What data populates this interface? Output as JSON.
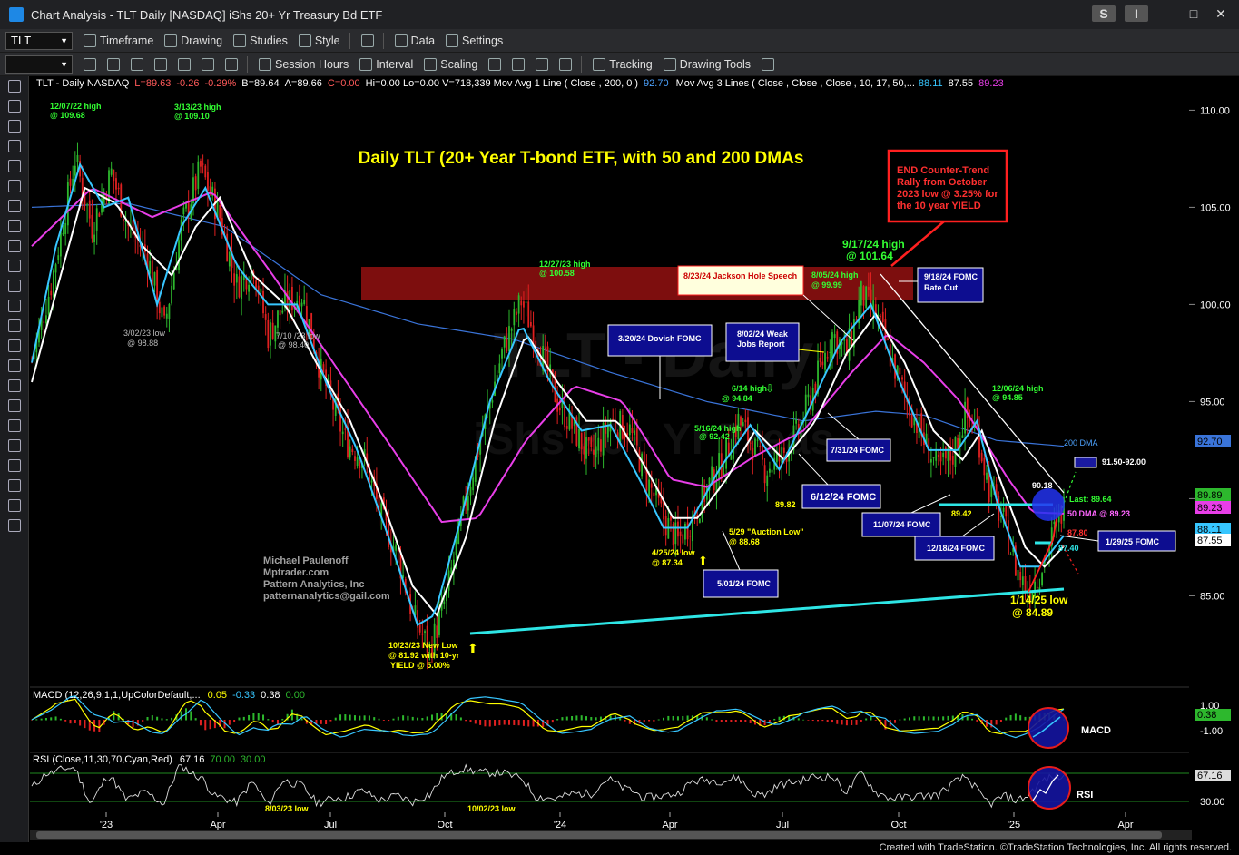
{
  "window": {
    "title": "Chart Analysis - TLT Daily [NASDAQ] iShs 20+ Yr Treasury Bd ETF",
    "btn_s": "S",
    "btn_i": "I"
  },
  "toolbar1": {
    "symbol": "TLT",
    "timeframe": "Timeframe",
    "drawing": "Drawing",
    "studies": "Studies",
    "style": "Style",
    "data": "Data",
    "settings": "Settings"
  },
  "toolbar2": {
    "session": "Session Hours",
    "interval": "Interval",
    "scaling": "Scaling",
    "tracking": "Tracking",
    "drawing_tools": "Drawing Tools"
  },
  "header": {
    "sym": "TLT - Daily NASDAQ",
    "last": "L=89.63",
    "chg": "-0.26",
    "pct": "-0.29%",
    "bid": "B=89.64",
    "ask": "A=89.66",
    "net": "C=0.00",
    "rest": "Hi=0.00  Lo=0.00  V=718,339  Mov Avg 1 Line ( Close , 200,  0 )",
    "ma1": "92.70",
    "ma3": "Mov Avg 3 Lines ( Close , Close , Close , 10, 17, 50,...",
    "ma3a": "88.11",
    "ma3b": "87.55",
    "ma3c": "89.23"
  },
  "colors": {
    "up": "#2db82d",
    "down": "#e02020",
    "ma10": "#37c6ff",
    "ma17": "#ffffff",
    "ma50": "#e83ee8",
    "ma200": "#3a74d9",
    "resist": "#8b1010",
    "trend": "#2ee6e6",
    "ann": "#ffff00",
    "green": "#33ff33"
  },
  "chart_data": {
    "type": "candlestick",
    "title": "Daily TLT (20+ Year T-bond ETF, with 50 and 200 DMAs",
    "ylim": [
      81,
      111
    ],
    "y_ticks": [
      "110.00",
      "105.00",
      "100.00",
      "95.00",
      "90.00",
      "85.00"
    ],
    "x_ticks": [
      "'23",
      "Apr",
      "Jul",
      "Oct",
      "'24",
      "Apr",
      "Jul",
      "Oct",
      "'25",
      "Apr"
    ],
    "price_path": [
      [
        0,
        97.2
      ],
      [
        8,
        101
      ],
      [
        18,
        107.5
      ],
      [
        25,
        104
      ],
      [
        33,
        106.8
      ],
      [
        40,
        104
      ],
      [
        48,
        102.5
      ],
      [
        55,
        98.8
      ],
      [
        62,
        104
      ],
      [
        70,
        107
      ],
      [
        78,
        104.5
      ],
      [
        85,
        101
      ],
      [
        92,
        102
      ],
      [
        98,
        98.4
      ],
      [
        105,
        100
      ],
      [
        112,
        100.5
      ],
      [
        120,
        96.5
      ],
      [
        130,
        93
      ],
      [
        138,
        92
      ],
      [
        145,
        89
      ],
      [
        152,
        87
      ],
      [
        158,
        84
      ],
      [
        165,
        82.2
      ],
      [
        172,
        85
      ],
      [
        180,
        90
      ],
      [
        188,
        94
      ],
      [
        195,
        97.5
      ],
      [
        203,
        100.2
      ],
      [
        210,
        98
      ],
      [
        218,
        95
      ],
      [
        225,
        93.5
      ],
      [
        232,
        92
      ],
      [
        240,
        94
      ],
      [
        248,
        93.5
      ],
      [
        255,
        91
      ],
      [
        262,
        89
      ],
      [
        268,
        87.8
      ],
      [
        274,
        89
      ],
      [
        280,
        90.5
      ],
      [
        287,
        92
      ],
      [
        293,
        94
      ],
      [
        298,
        93
      ],
      [
        304,
        91.5
      ],
      [
        310,
        92
      ],
      [
        318,
        93.5
      ],
      [
        325,
        96
      ],
      [
        332,
        98.5
      ],
      [
        338,
        97.5
      ],
      [
        344,
        100.5
      ],
      [
        350,
        99.5
      ],
      [
        357,
        97
      ],
      [
        363,
        95
      ],
      [
        370,
        93
      ],
      [
        376,
        91.5
      ],
      [
        382,
        92.3
      ],
      [
        387,
        94.3
      ],
      [
        392,
        93.5
      ],
      [
        397,
        90.5
      ],
      [
        403,
        88.8
      ],
      [
        408,
        86.5
      ],
      [
        413,
        85.2
      ],
      [
        418,
        86.2
      ],
      [
        423,
        88
      ],
      [
        428,
        89.6
      ]
    ],
    "last_x": 428,
    "series": [
      {
        "name": "200 DMA",
        "path": [
          [
            0,
            105
          ],
          [
            40,
            105.2
          ],
          [
            80,
            104
          ],
          [
            120,
            100.5
          ],
          [
            160,
            99
          ],
          [
            200,
            98.2
          ],
          [
            240,
            96.5
          ],
          [
            280,
            95
          ],
          [
            320,
            94
          ],
          [
            350,
            94.5
          ],
          [
            370,
            94.3
          ],
          [
            400,
            93
          ],
          [
            428,
            92.7
          ]
        ]
      },
      {
        "name": "50 DMA",
        "path": [
          [
            0,
            103
          ],
          [
            25,
            106
          ],
          [
            50,
            104.5
          ],
          [
            75,
            105.8
          ],
          [
            100,
            101.5
          ],
          [
            125,
            97
          ],
          [
            150,
            92.5
          ],
          [
            170,
            88.8
          ],
          [
            185,
            89
          ],
          [
            205,
            93
          ],
          [
            225,
            95.8
          ],
          [
            245,
            95
          ],
          [
            265,
            91
          ],
          [
            280,
            90.6
          ],
          [
            300,
            92.2
          ],
          [
            320,
            93.5
          ],
          [
            340,
            96.5
          ],
          [
            355,
            98.5
          ],
          [
            370,
            97
          ],
          [
            385,
            95
          ],
          [
            405,
            91
          ],
          [
            415,
            89.3
          ],
          [
            428,
            89.23
          ]
        ]
      },
      {
        "name": "ma10",
        "path": [
          [
            0,
            97
          ],
          [
            10,
            103
          ],
          [
            20,
            107.2
          ],
          [
            30,
            105
          ],
          [
            40,
            105.5
          ],
          [
            52,
            100
          ],
          [
            62,
            104
          ],
          [
            72,
            106
          ],
          [
            85,
            102
          ],
          [
            98,
            100
          ],
          [
            110,
            100
          ],
          [
            122,
            96
          ],
          [
            135,
            92.5
          ],
          [
            148,
            88
          ],
          [
            160,
            83.5
          ],
          [
            167,
            84
          ],
          [
            178,
            89
          ],
          [
            190,
            95
          ],
          [
            203,
            99
          ],
          [
            215,
            96
          ],
          [
            228,
            93.5
          ],
          [
            240,
            93.8
          ],
          [
            252,
            91
          ],
          [
            262,
            88.5
          ],
          [
            272,
            88.5
          ],
          [
            285,
            91.5
          ],
          [
            298,
            93.8
          ],
          [
            310,
            91.5
          ],
          [
            322,
            94.5
          ],
          [
            335,
            98
          ],
          [
            348,
            100
          ],
          [
            360,
            96
          ],
          [
            372,
            92.5
          ],
          [
            384,
            92.5
          ],
          [
            392,
            94
          ],
          [
            400,
            90
          ],
          [
            410,
            86.5
          ],
          [
            418,
            86.5
          ],
          [
            428,
            88.1
          ]
        ]
      },
      {
        "name": "ma17",
        "path": [
          [
            0,
            96
          ],
          [
            12,
            101.5
          ],
          [
            22,
            106
          ],
          [
            35,
            105.2
          ],
          [
            46,
            103
          ],
          [
            58,
            101.5
          ],
          [
            68,
            104
          ],
          [
            78,
            105.5
          ],
          [
            92,
            101.5
          ],
          [
            105,
            100
          ],
          [
            118,
            97
          ],
          [
            132,
            94
          ],
          [
            145,
            90
          ],
          [
            158,
            85.5
          ],
          [
            168,
            84
          ],
          [
            180,
            88
          ],
          [
            192,
            94
          ],
          [
            205,
            98.5
          ],
          [
            218,
            96
          ],
          [
            230,
            94
          ],
          [
            243,
            94
          ],
          [
            255,
            91.5
          ],
          [
            266,
            89
          ],
          [
            276,
            89
          ],
          [
            288,
            91
          ],
          [
            300,
            93.5
          ],
          [
            312,
            92
          ],
          [
            325,
            94
          ],
          [
            338,
            97.5
          ],
          [
            350,
            99.5
          ],
          [
            362,
            97
          ],
          [
            374,
            93.5
          ],
          [
            386,
            92
          ],
          [
            394,
            93.5
          ],
          [
            403,
            90.5
          ],
          [
            412,
            87.5
          ],
          [
            420,
            86.5
          ],
          [
            428,
            87.55
          ]
        ]
      }
    ],
    "annotations": {
      "a1": "12/07/22 high",
      "a1b": "@ 109.68",
      "a2": "3/13/23 high",
      "a2b": "@ 109.10",
      "a3": "3/02/23 low",
      "a3b": "@ 98.88",
      "a4": "7/10 /23 low",
      "a4b": "@ 98.40",
      "a5": "12/27/23 high",
      "a5b": "@ 100.58",
      "a6": "10/23/23 New Low",
      "a6b": "@ 81.92 with 10-yr",
      "a6c": "YIELD @ 5.00%",
      "a7": "6/14 high",
      "a7b": "@ 94.84",
      "a8": "5/16/24 high",
      "a8b": "@ 92.42",
      "a9": "4/25/24 low",
      "a9b": "@ 87.34",
      "a10": "5/29 \"Auction Low\"",
      "a10b": "@ 88.68",
      "a11": "89.82",
      "a12": "8/05/24 high",
      "a12b": "@ 99.99",
      "a13": "9/17/24 high",
      "a13b": "@ 101.64",
      "a14": "12/06/24 high",
      "a14b": "@ 94.85",
      "a15": "89.42",
      "a16": "90.18",
      "a17": "1/14/25 low",
      "a17b": "@ 84.89",
      "a18": "200 DMA",
      "a19": "91.50-92.00",
      "a20": "Last: 89.64",
      "a21": "50 DMA @ 89.23",
      "a22": "87.80",
      "a23": "87.40",
      "b1": "3/20/24 Dovish FOMC",
      "b2": "8/02/24 Weak",
      "b2b": "Jobs Report",
      "b3": "8/23/24 Jackson Hole Speech",
      "b4": "9/18/24 FOMC",
      "b4b": "Rate Cut",
      "b5": "7/31/24 FOMC",
      "b6": "6/12/24 FOMC",
      "b7": "5/01/24 FOMC",
      "b8": "11/07/24 FOMC",
      "b9": "12/18/24 FOMC",
      "b10": "1/29/25 FOMC",
      "red1": "END Counter-Trend",
      "red2": "Rally from October",
      "red3": "2023 low @ 3.25% for",
      "red4": "the 10 year YIELD",
      "sig1": "Michael Paulenoff",
      "sig2": "Mptrader.com",
      "sig3": "Pattern Analytics, Inc",
      "sig4": "patternanalytics@gail.com",
      "wm1": "TLT - Daily",
      "wm2": "iShs 20+ Yr Treas"
    },
    "price_tags": {
      "t1": "92.70",
      "t2": "89.89",
      "t3": "89.23",
      "t4": "88.11",
      "t5": "87.55"
    }
  },
  "macd": {
    "label": "MACD (12,26,9,1,1,UpColorDefault,...",
    "v1": "0.05",
    "v2": "-0.33",
    "v3": "0.38",
    "v4": "0.00",
    "name": "MACD",
    "y1": "1.00",
    "y2": "0.38",
    "y3": "-1.00"
  },
  "rsi": {
    "label": "RSI (Close,11,30,70,Cyan,Red)",
    "v1": "67.16",
    "v2": "70.00",
    "v3": "30.00",
    "name": "RSI",
    "y1": "67.16",
    "y2": "30.00",
    "n1": "8/03/23 low",
    "n2": "10/02/23 low"
  },
  "status": "Created with TradeStation. ©TradeStation Technologies, Inc. All rights reserved."
}
